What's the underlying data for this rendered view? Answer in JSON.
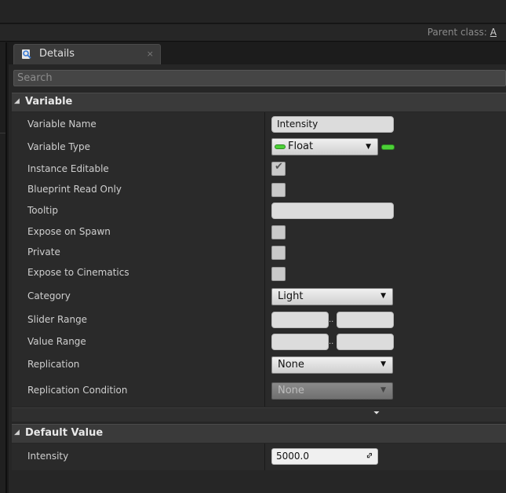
{
  "header": {
    "parent_class_label": "Parent class:",
    "parent_class_value": "A"
  },
  "details_tab": {
    "label": "Details",
    "close": "×",
    "icon": "magnifier-doc-icon"
  },
  "search": {
    "placeholder": "Search"
  },
  "variable_category": {
    "arrow": "◢",
    "title": "Variable",
    "rows": {
      "variable_name": {
        "label": "Variable Name",
        "value": "Intensity"
      },
      "variable_type": {
        "label": "Variable Type",
        "value": "Float"
      },
      "instance_editable": {
        "label": "Instance Editable",
        "checked": true
      },
      "blueprint_read_only": {
        "label": "Blueprint Read Only",
        "checked": false
      },
      "tooltip": {
        "label": "Tooltip",
        "value": ""
      },
      "expose_on_spawn": {
        "label": "Expose on Spawn",
        "checked": false
      },
      "private": {
        "label": "Private",
        "checked": false
      },
      "expose_to_cinematics": {
        "label": "Expose to Cinematics",
        "checked": false
      },
      "category": {
        "label": "Category",
        "value": "Light"
      },
      "slider_range": {
        "label": "Slider Range",
        "separator": ".."
      },
      "value_range": {
        "label": "Value Range",
        "separator": ".."
      },
      "replication": {
        "label": "Replication",
        "value": "None"
      },
      "replication_condition": {
        "label": "Replication Condition",
        "value": "None"
      }
    }
  },
  "default_value_category": {
    "arrow": "◢",
    "title": "Default Value",
    "rows": {
      "intensity": {
        "label": "Intensity",
        "value": "5000.0"
      }
    }
  },
  "icons": {
    "dropdown": "▼",
    "checkmark": "✔",
    "advanced_expand": "⏷",
    "reset": "⇕"
  },
  "colors": {
    "float_pin": "#4cd137",
    "panel_bg": "#262626",
    "header_bg": "#3a3a3a"
  }
}
